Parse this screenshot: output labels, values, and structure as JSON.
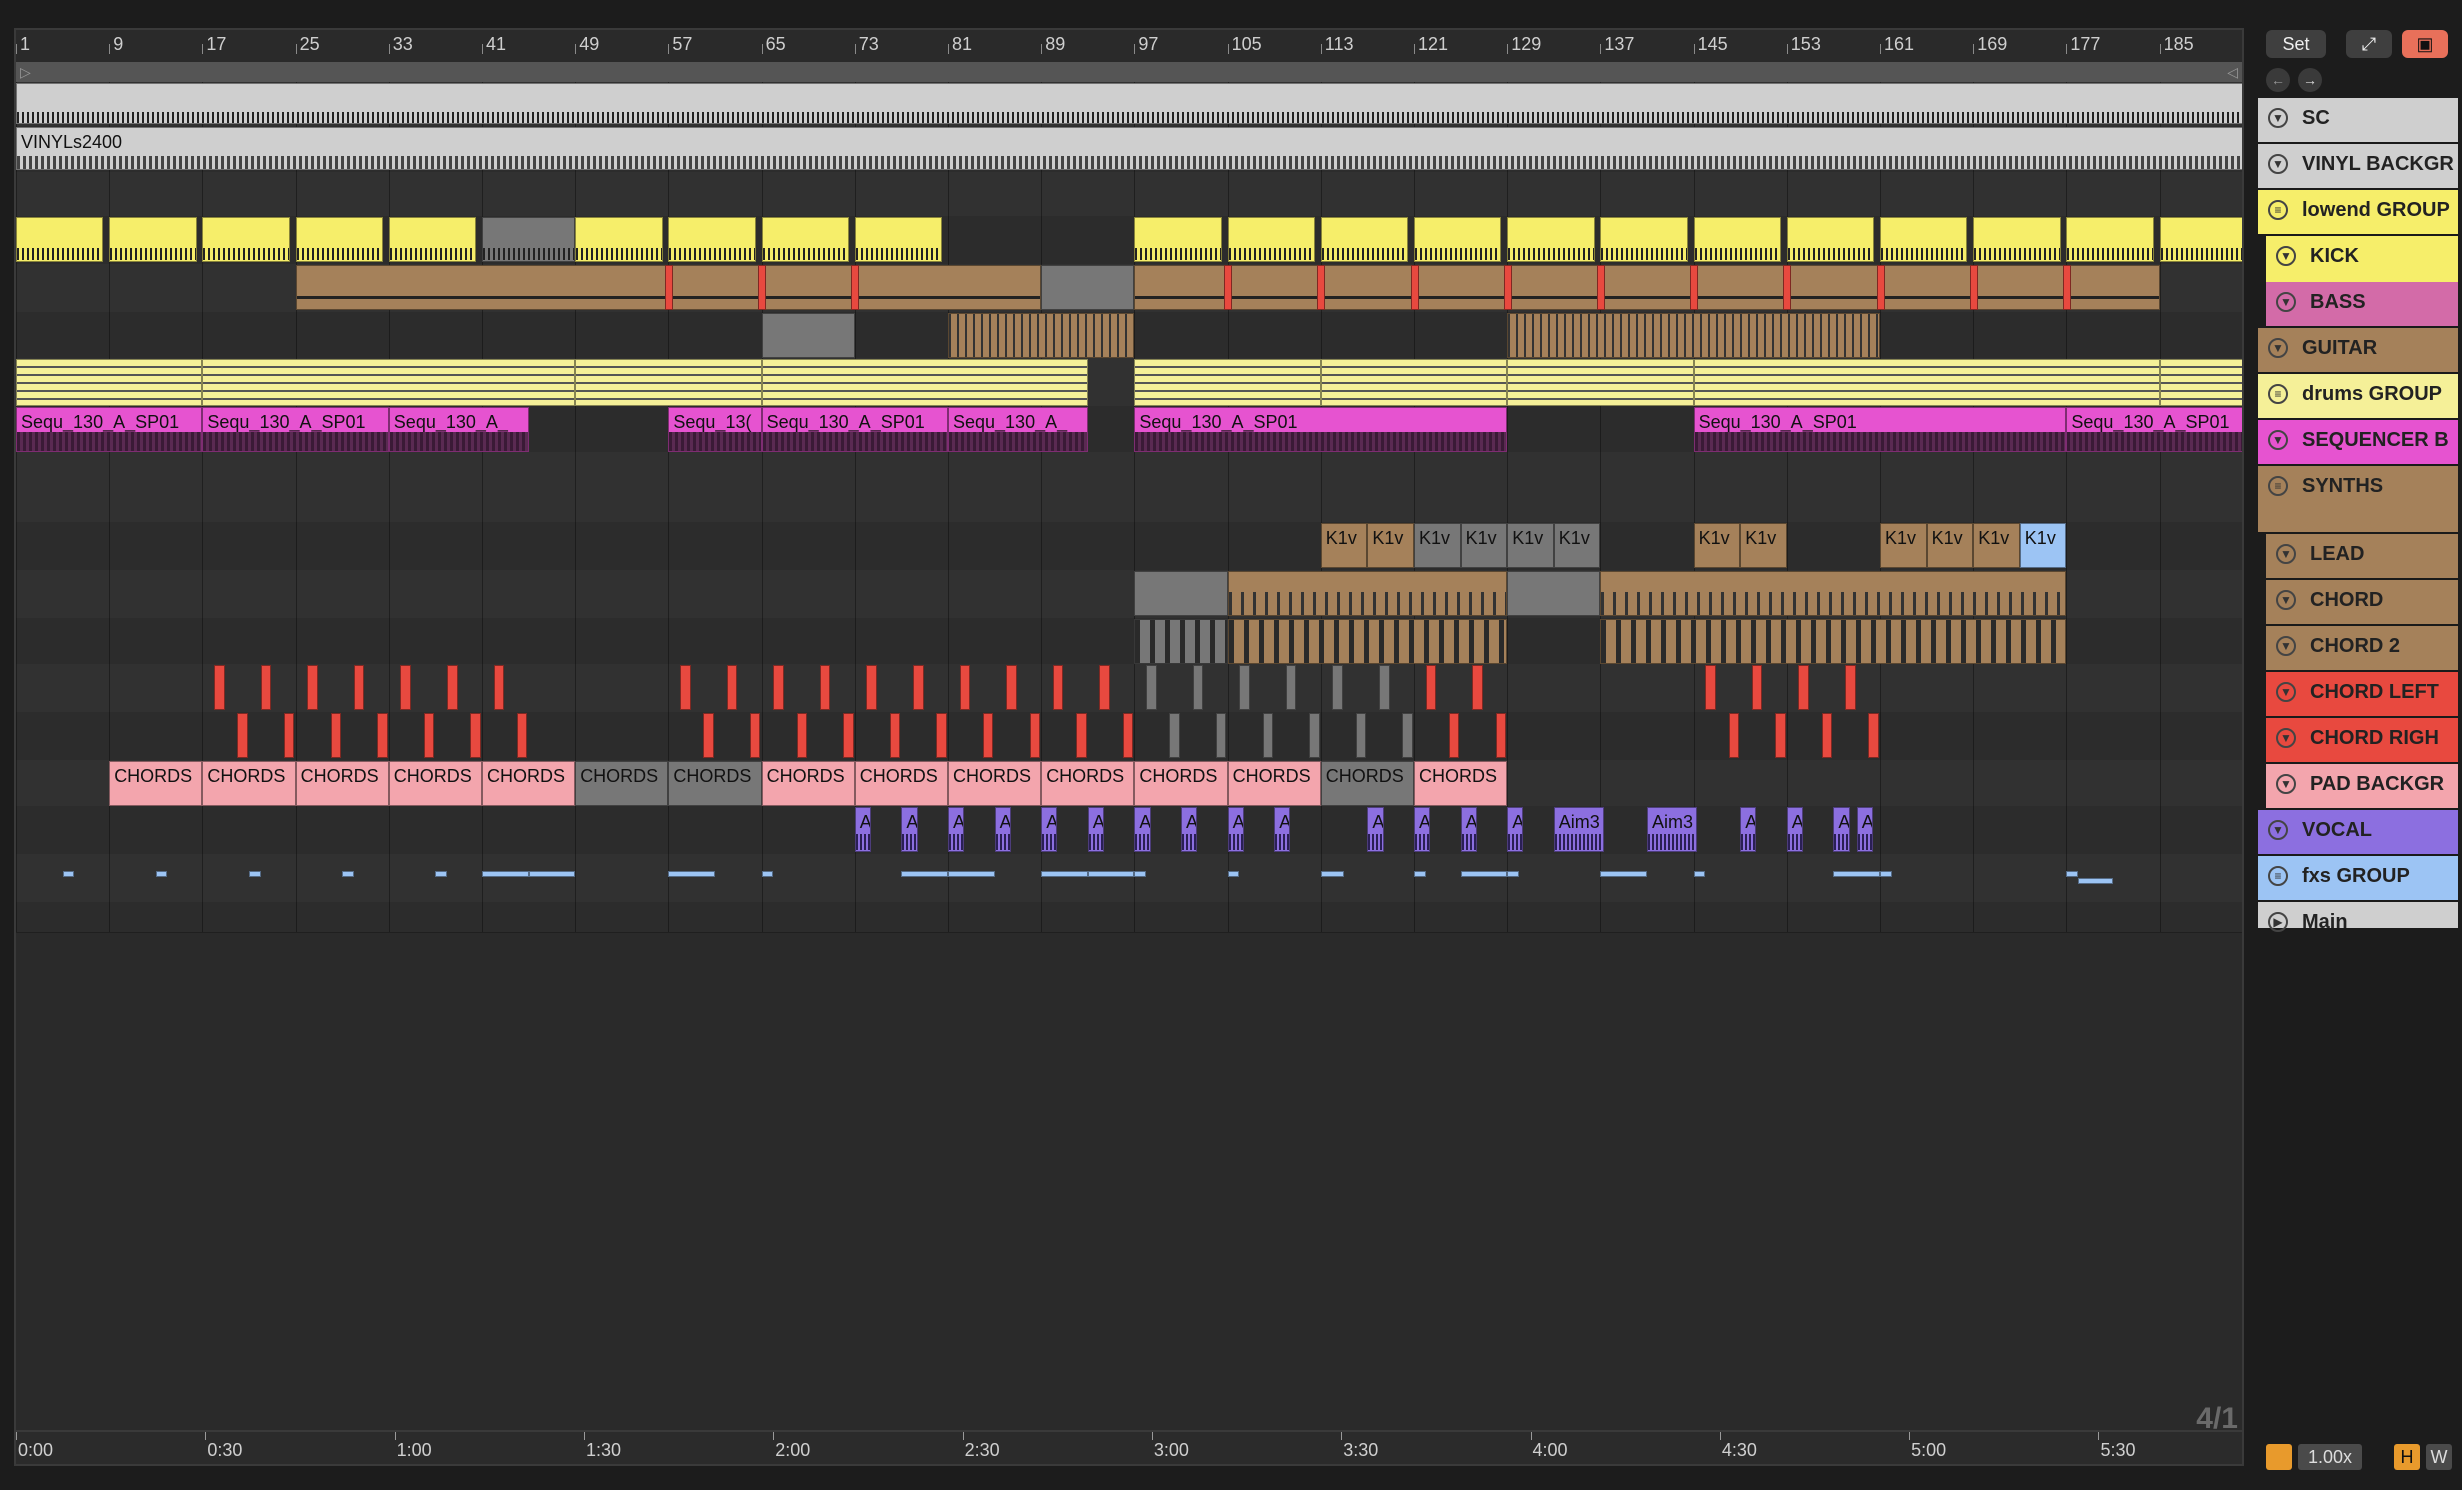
{
  "ruler": {
    "bars": [
      "1",
      "9",
      "17",
      "25",
      "33",
      "41",
      "49",
      "57",
      "65",
      "73",
      "81",
      "89",
      "97",
      "105",
      "113",
      "121",
      "129",
      "137",
      "145",
      "153",
      "161",
      "169",
      "177",
      "185"
    ],
    "times": [
      "0:00",
      "0:30",
      "1:00",
      "1:30",
      "2:00",
      "2:30",
      "3:00",
      "3:30",
      "4:00",
      "4:30",
      "5:00",
      "5:30"
    ]
  },
  "controls": {
    "set_label": "Set",
    "expand_icon": "expand-icon",
    "lock_icon": "lock-icon",
    "back_icon": "arrow-left-icon",
    "forward_icon": "arrow-right-icon"
  },
  "clips": {
    "vinyl": "VINYLs2400",
    "sequ_full": "Sequ_130_A_SP01",
    "sequ_short": "Sequ_130_A_",
    "sequ_cut": "Sequ_13(",
    "k1v": "K1v",
    "chords": "CHORDS",
    "aim": "Ai",
    "aim_a": "A",
    "aim3": "Aim3",
    "ain": "Ain"
  },
  "tracks": [
    {
      "name": "SC",
      "color": "#cfcfcf"
    },
    {
      "name": "VINYL BACKGR",
      "color": "#cfcfcf"
    },
    {
      "name": "lowend GROUP",
      "color": "#f6ee6a"
    },
    {
      "name": "KICK",
      "color": "#f6ee6a"
    },
    {
      "name": "BASS",
      "color": "#d36ba8"
    },
    {
      "name": "GUITAR",
      "color": "#a5815a"
    },
    {
      "name": "drums GROUP",
      "color": "#f5f098"
    },
    {
      "name": "SEQUENCER B",
      "color": "#e653d0"
    },
    {
      "name": "SYNTHS",
      "color": "#a5815a"
    },
    {
      "name": "LEAD",
      "color": "#a5815a"
    },
    {
      "name": "CHORD",
      "color": "#a5815a"
    },
    {
      "name": "CHORD 2",
      "color": "#a5815a"
    },
    {
      "name": "CHORD LEFT",
      "color": "#e8493f"
    },
    {
      "name": "CHORD RIGH",
      "color": "#e8493f"
    },
    {
      "name": "PAD BACKGR",
      "color": "#f3a5ad"
    },
    {
      "name": "VOCAL",
      "color": "#8c6fe0"
    },
    {
      "name": "fxs GROUP",
      "color": "#9cc4f4"
    },
    {
      "name": "Main",
      "color": "#cfcfcf"
    }
  ],
  "status": {
    "page_indicator": "4/1",
    "zoom": "1.00x",
    "h_label": "H",
    "w_label": "W"
  }
}
